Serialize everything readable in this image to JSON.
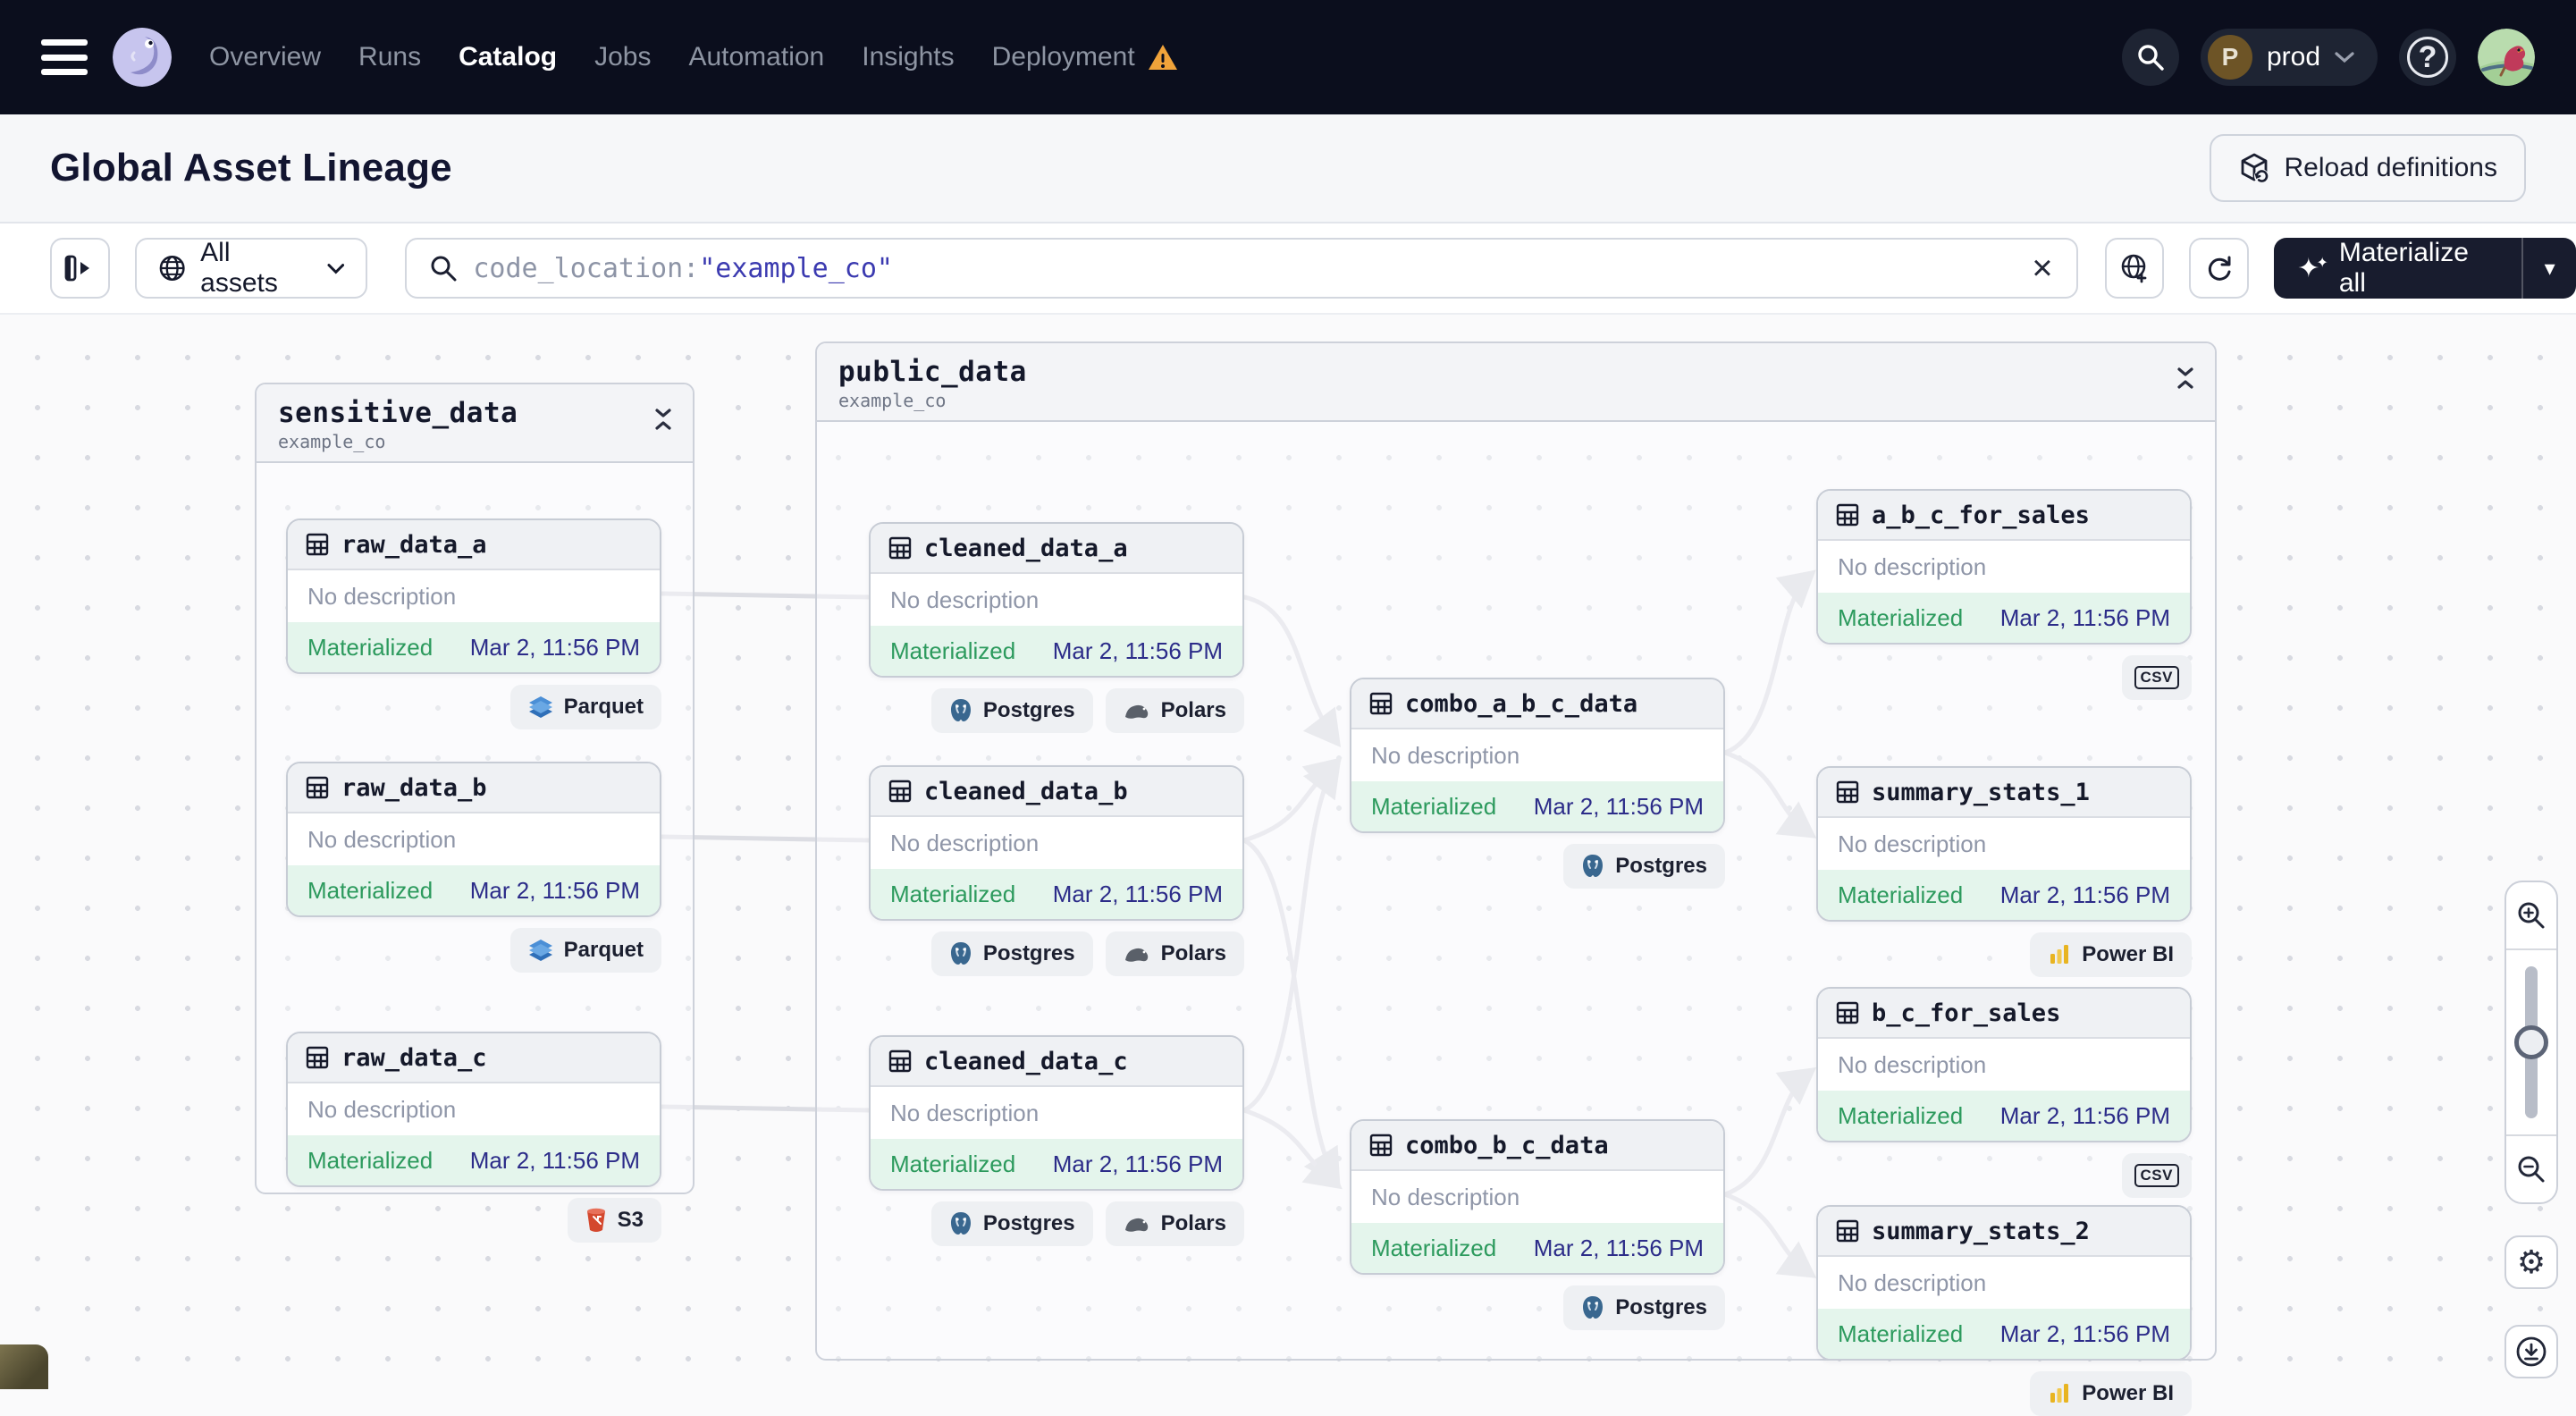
{
  "nav": {
    "items": [
      {
        "label": "Overview"
      },
      {
        "label": "Runs"
      },
      {
        "label": "Catalog"
      },
      {
        "label": "Jobs"
      },
      {
        "label": "Automation"
      },
      {
        "label": "Insights"
      },
      {
        "label": "Deployment"
      }
    ],
    "active_item": "Catalog",
    "env": {
      "label": "prod",
      "avatar_letter": "P"
    },
    "help_glyph": "?"
  },
  "header": {
    "title": "Global Asset Lineage",
    "reload_button_label": "Reload definitions"
  },
  "toolbar": {
    "filter_dropdown_label": "All assets",
    "search_prefix": "code_location:",
    "search_value": "\"example_co\"",
    "materialize_button_label": "Materialize all"
  },
  "icons": {
    "clear": "×",
    "caret_down": "▾",
    "sparkle": "✦",
    "gear": "⚙"
  },
  "graph": {
    "groups": [
      {
        "name": "sensitive_data",
        "location": "example_co"
      },
      {
        "name": "public_data",
        "location": "example_co"
      }
    ],
    "nodes": [
      {
        "name": "raw_data_a",
        "description": "No description",
        "status": "Materialized",
        "timestamp": "Mar 2, 11:56 PM",
        "tags": [
          {
            "label": "Parquet",
            "icon": "parquet-icon"
          }
        ]
      },
      {
        "name": "raw_data_b",
        "description": "No description",
        "status": "Materialized",
        "timestamp": "Mar 2, 11:56 PM",
        "tags": [
          {
            "label": "Parquet",
            "icon": "parquet-icon"
          }
        ]
      },
      {
        "name": "raw_data_c",
        "description": "No description",
        "status": "Materialized",
        "timestamp": "Mar 2, 11:56 PM",
        "tags": [
          {
            "label": "S3",
            "icon": "s3-icon"
          }
        ]
      },
      {
        "name": "cleaned_data_a",
        "description": "No description",
        "status": "Materialized",
        "timestamp": "Mar 2, 11:56 PM",
        "tags": [
          {
            "label": "Postgres",
            "icon": "postgres-icon"
          },
          {
            "label": "Polars",
            "icon": "polars-icon"
          }
        ]
      },
      {
        "name": "cleaned_data_b",
        "description": "No description",
        "status": "Materialized",
        "timestamp": "Mar 2, 11:56 PM",
        "tags": [
          {
            "label": "Postgres",
            "icon": "postgres-icon"
          },
          {
            "label": "Polars",
            "icon": "polars-icon"
          }
        ]
      },
      {
        "name": "cleaned_data_c",
        "description": "No description",
        "status": "Materialized",
        "timestamp": "Mar 2, 11:56 PM",
        "tags": [
          {
            "label": "Postgres",
            "icon": "postgres-icon"
          },
          {
            "label": "Polars",
            "icon": "polars-icon"
          }
        ]
      },
      {
        "name": "combo_a_b_c_data",
        "description": "No description",
        "status": "Materialized",
        "timestamp": "Mar 2, 11:56 PM",
        "tags": [
          {
            "label": "Postgres",
            "icon": "postgres-icon"
          }
        ]
      },
      {
        "name": "combo_b_c_data",
        "description": "No description",
        "status": "Materialized",
        "timestamp": "Mar 2, 11:56 PM",
        "tags": [
          {
            "label": "Postgres",
            "icon": "postgres-icon"
          }
        ]
      },
      {
        "name": "a_b_c_for_sales",
        "description": "No description",
        "status": "Materialized",
        "timestamp": "Mar 2, 11:56 PM",
        "tags": [
          {
            "label": "csv",
            "icon": "csv-icon"
          }
        ]
      },
      {
        "name": "summary_stats_1",
        "description": "No description",
        "status": "Materialized",
        "timestamp": "Mar 2, 11:56 PM",
        "tags": [
          {
            "label": "Power BI",
            "icon": "powerbi-icon"
          }
        ]
      },
      {
        "name": "b_c_for_sales",
        "description": "No description",
        "status": "Materialized",
        "timestamp": "Mar 2, 11:56 PM",
        "tags": [
          {
            "label": "csv",
            "icon": "csv-icon"
          }
        ]
      },
      {
        "name": "summary_stats_2",
        "description": "No description",
        "status": "Materialized",
        "timestamp": "Mar 2, 11:56 PM",
        "tags": [
          {
            "label": "Power BI",
            "icon": "powerbi-icon"
          }
        ]
      }
    ]
  }
}
